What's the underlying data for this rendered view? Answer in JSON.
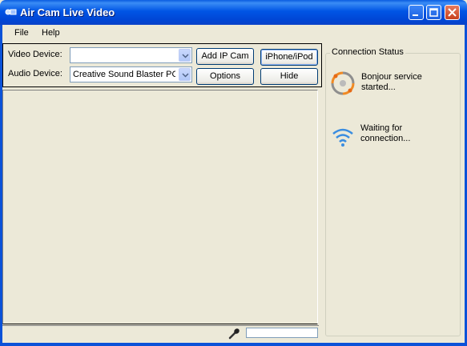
{
  "window": {
    "title": "Air Cam Live Video"
  },
  "menu": {
    "file": "File",
    "help": "Help"
  },
  "devices": {
    "video_label": "Video Device:",
    "video_value": "",
    "audio_label": "Audio Device:",
    "audio_value": "Creative Sound Blaster PCI"
  },
  "buttons": {
    "add_ip_cam": "Add IP Cam",
    "iphone_ipod": "iPhone/iPod",
    "options": "Options",
    "hide": "Hide"
  },
  "status": {
    "legend": "Connection Status",
    "bonjour": "Bonjour service started...",
    "waiting": "Waiting for connection..."
  },
  "colors": {
    "titlebar": "#0055e5",
    "window_bg": "#ece9d8",
    "accent": "#0b52d8"
  },
  "icons": {
    "app": "camera-icon",
    "bonjour": "bonjour-icon",
    "wifi": "wifi-icon",
    "mic": "microphone-icon"
  }
}
